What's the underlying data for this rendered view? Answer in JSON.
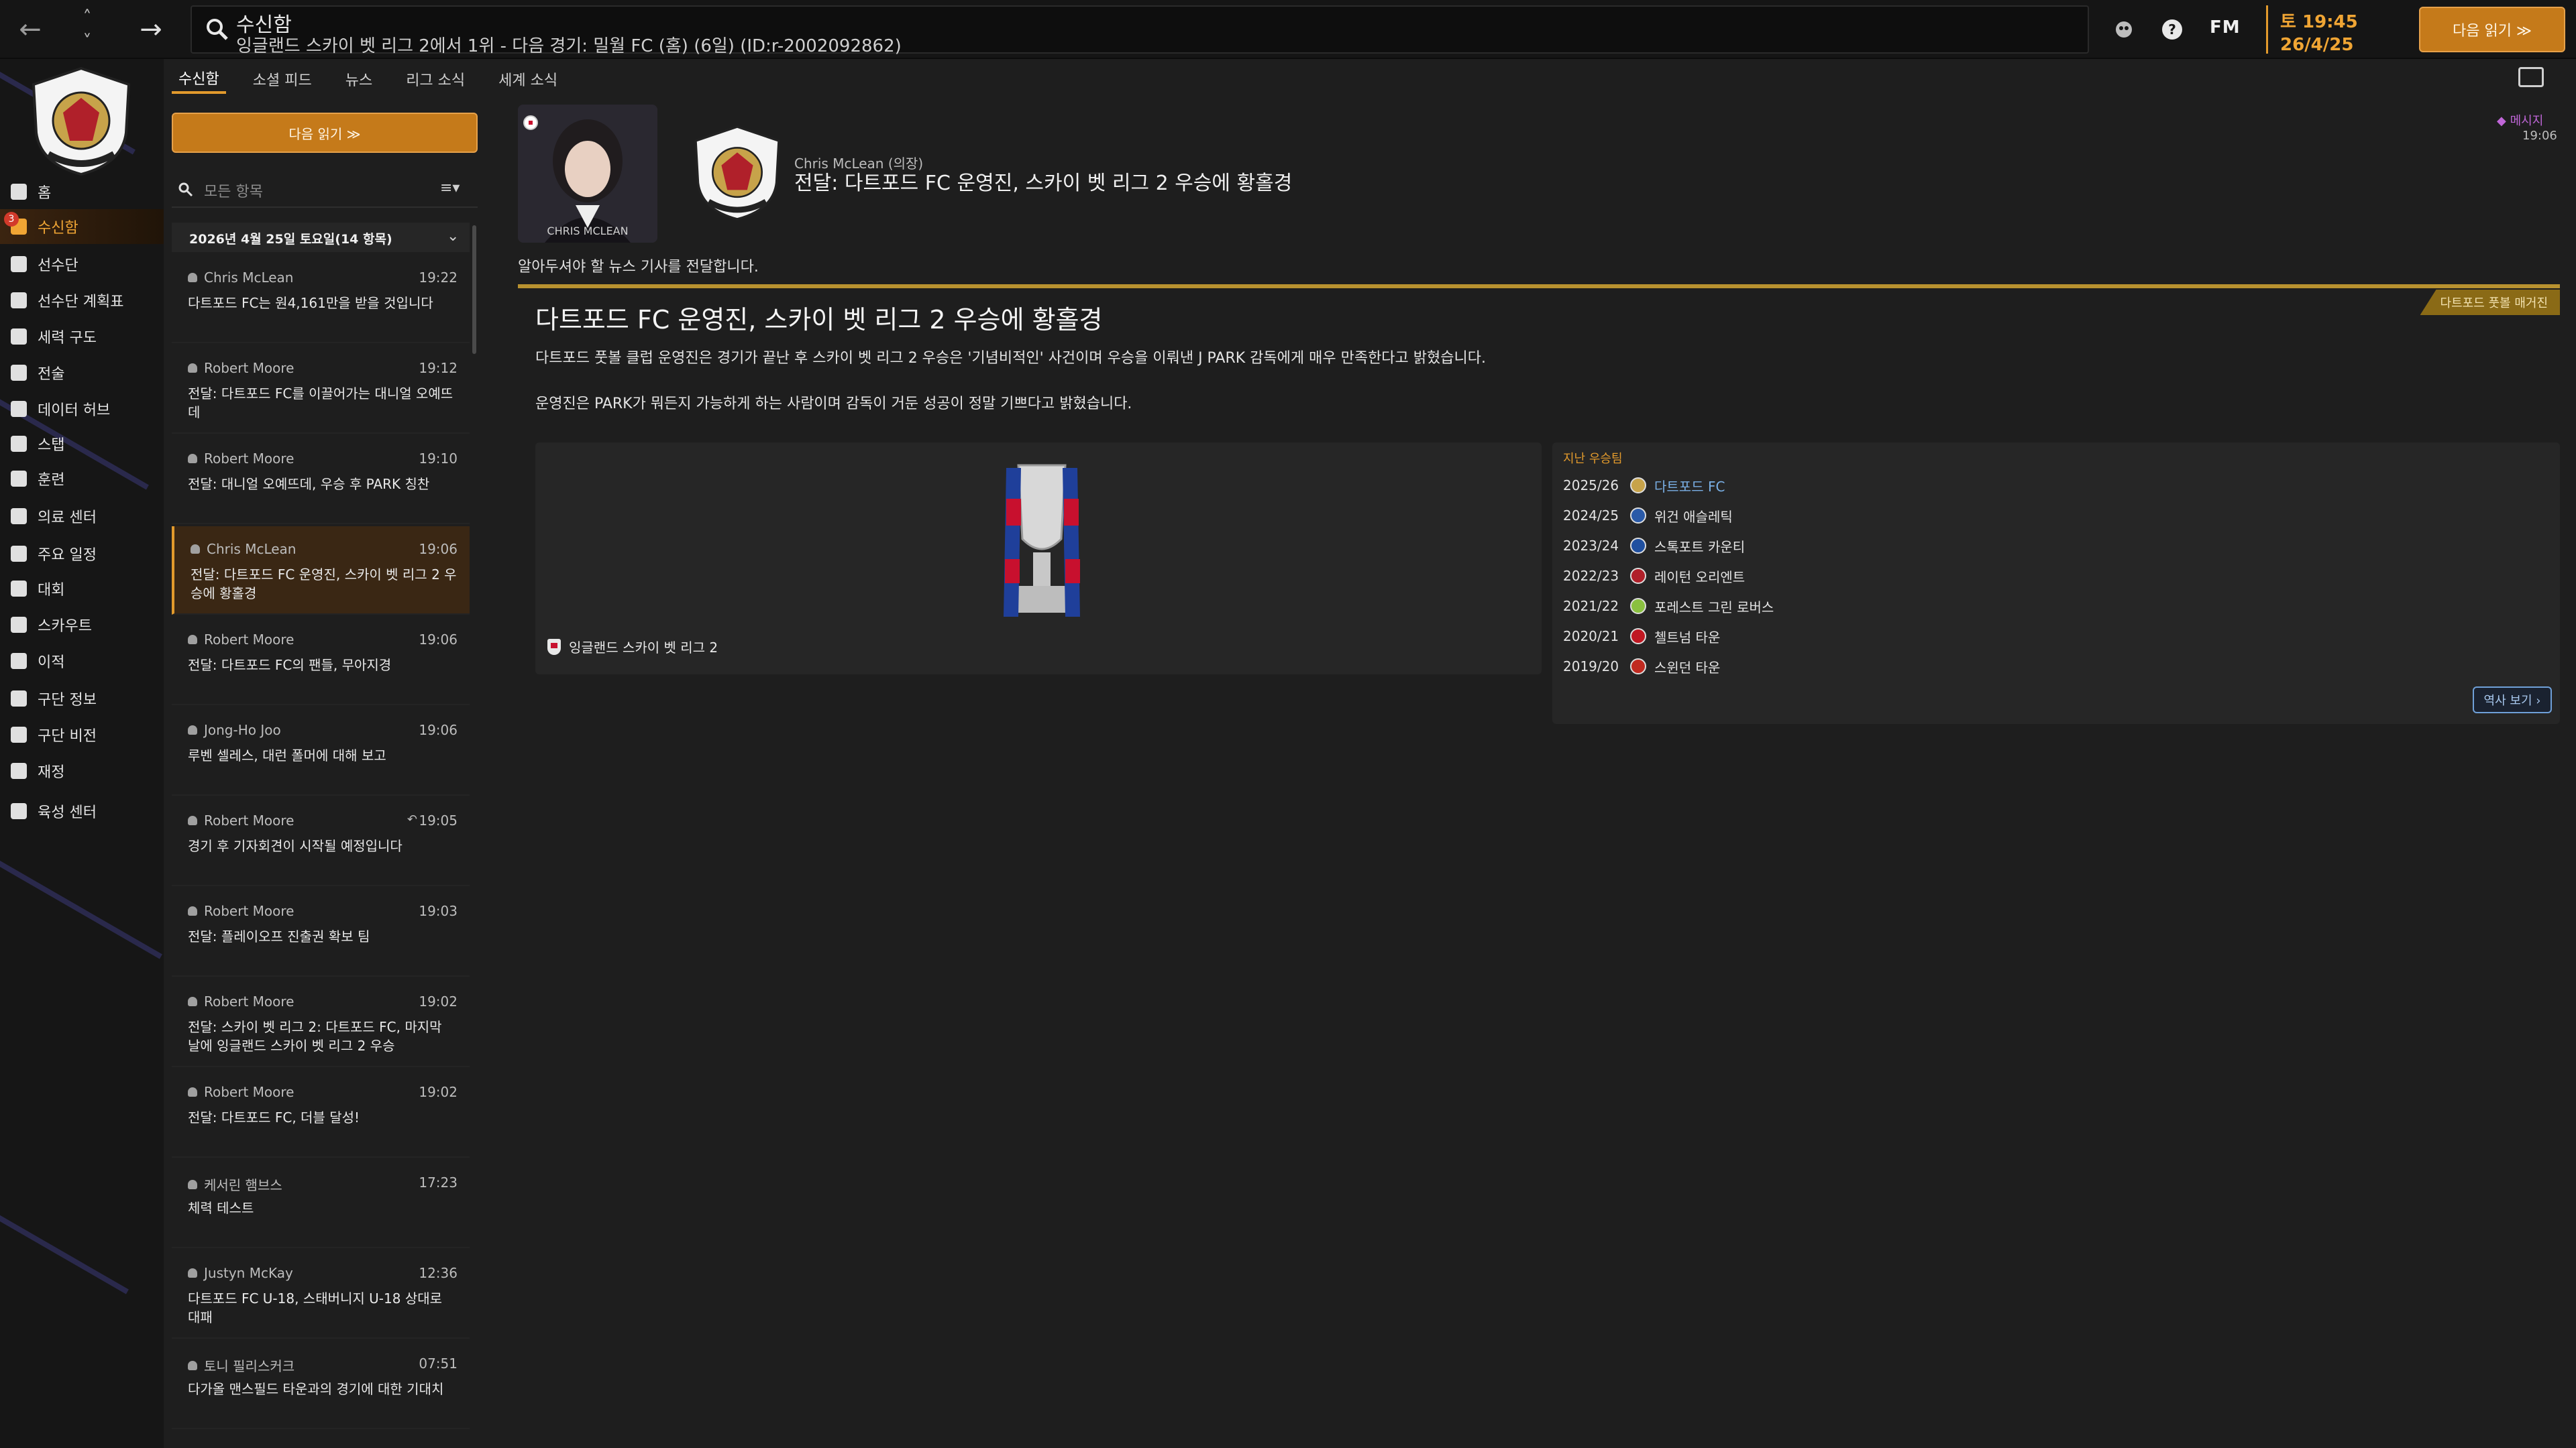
{
  "topbar": {
    "title": "수신함",
    "subtitle": "잉글랜드 스카이 벳 리그 2에서 1위 - 다음 경기: 밀월 FC (홈) (6일) (ID:r-2002092862)",
    "fm_label": "FM",
    "time": "토 19:45",
    "date": "26/4/25",
    "continue_label": "다음 읽기 ≫"
  },
  "sidebar": {
    "badge_count": "3",
    "items": [
      {
        "label": "홈",
        "icon": "home-icon"
      },
      {
        "label": "수신함",
        "icon": "inbox-icon"
      },
      {
        "label": "선수단",
        "icon": "squad-icon"
      },
      {
        "label": "선수단 계획표",
        "icon": "squad-planner-icon"
      },
      {
        "label": "세력 구도",
        "icon": "dynamics-icon"
      },
      {
        "label": "전술",
        "icon": "tactics-icon"
      },
      {
        "label": "데이터 허브",
        "icon": "data-hub-icon"
      },
      {
        "label": "스탭",
        "icon": "staff-icon"
      },
      {
        "label": "훈련",
        "icon": "training-icon"
      },
      {
        "label": "의료 센터",
        "icon": "medical-icon"
      },
      {
        "label": "주요 일정",
        "icon": "schedule-icon"
      },
      {
        "label": "대회",
        "icon": "trophy-icon"
      },
      {
        "label": "스카우트",
        "icon": "scouting-icon"
      },
      {
        "label": "이적",
        "icon": "transfers-icon"
      },
      {
        "label": "구단 정보",
        "icon": "club-info-icon"
      },
      {
        "label": "구단 비전",
        "icon": "club-vision-icon"
      },
      {
        "label": "재정",
        "icon": "finances-icon"
      },
      {
        "label": "육성 센터",
        "icon": "development-icon"
      }
    ]
  },
  "tabs": [
    "수신함",
    "소셜 피드",
    "뉴스",
    "리그 소식",
    "세계 소식"
  ],
  "inbox": {
    "continue_label": "다음 읽기 ≫",
    "filter_placeholder": "모든 항목",
    "sort_icon": "≡▾",
    "date_header": "2026년 4월 25일 토요일(14 항목)",
    "messages": [
      {
        "from": "Chris McLean",
        "time": "19:22",
        "subject": "다트포드 FC는 원4,161만을 받을 것입니다"
      },
      {
        "from": "Robert Moore",
        "time": "19:12",
        "subject": "전달: 다트포드 FC를 이끌어가는 대니얼 오예뜨데"
      },
      {
        "from": "Robert Moore",
        "time": "19:10",
        "subject": "전달: 대니얼 오예뜨데, 우승 후 PARK 칭찬"
      },
      {
        "from": "Chris McLean",
        "time": "19:06",
        "subject": "전달: 다트포드 FC 운영진, 스카이 벳 리그 2 우승에 황홀경"
      },
      {
        "from": "Robert Moore",
        "time": "19:06",
        "subject": "전달: 다트포드 FC의 팬들, 무아지경"
      },
      {
        "from": "Jong-Ho Joo",
        "time": "19:06",
        "subject": "루벤 셀레스, 대런 폴머에 대해 보고"
      },
      {
        "from": "Robert Moore",
        "time": "19:05",
        "subject": "경기 후 기자회견이 시작될 예정입니다"
      },
      {
        "from": "Robert Moore",
        "time": "19:03",
        "subject": "전달: 플레이오프 진출권 확보 팀"
      },
      {
        "from": "Robert Moore",
        "time": "19:02",
        "subject": "전달: 스카이 벳 리그 2: 다트포드 FC, 마지막 날에 잉글랜드 스카이 벳 리그 2 우승"
      },
      {
        "from": "Robert Moore",
        "time": "19:02",
        "subject": "전달: 다트포드 FC, 더블 달성!"
      },
      {
        "from": "케서린 햄브스",
        "time": "17:23",
        "subject": "체력 테스트"
      },
      {
        "from": "Justyn McKay",
        "time": "12:36",
        "subject": "다트포드 FC U-18, 스태버니지 U-18 상대로 대패"
      },
      {
        "from": "토니 필리스커크",
        "time": "07:51",
        "subject": "다가올 맨스필드 타운과의 경기에 대한 기대치"
      }
    ]
  },
  "message": {
    "portrait_caption": "CHRIS MCLEAN",
    "sender": "Chris McLean (의장)",
    "subject": "전달: 다트포드 FC 운영진, 스카이 벳 리그 2 우승에 황홀경",
    "tag": "메시지",
    "time": "19:06",
    "intro": "알아두셔야 할 뉴스 기사를 전달합니다.",
    "source": "다트포드 풋볼 매거진",
    "headline": "다트포드 FC 운영진, 스카이 벳 리그 2 우승에 황홀경",
    "para1": "다트포드 풋볼 클럽 운영진은 경기가 끝난 후 스카이 벳 리그 2 우승은 '기념비적인' 사건이며 우승을 이뤄낸 J PARK 감독에게 매우 만족한다고 밝혔습니다.",
    "para2": "운영진은 PARK가 뭐든지 가능하게 하는 사람이며 감독이 거둔 성공이 정말 기쁘다고 밝혔습니다.",
    "competition": "잉글랜드 스카이 벳 리그 2",
    "winners_title": "지난 우승팀",
    "winners": [
      {
        "season": "2025/26",
        "club": "다트포드 FC",
        "color": "#c7a34a"
      },
      {
        "season": "2024/25",
        "club": "위건 애슬레틱",
        "color": "#2a5aa8"
      },
      {
        "season": "2023/24",
        "club": "스톡포트 카운티",
        "color": "#2050a0"
      },
      {
        "season": "2022/23",
        "club": "레이턴 오리엔트",
        "color": "#b0202a"
      },
      {
        "season": "2021/22",
        "club": "포레스트 그린 로버스",
        "color": "#8ac040"
      },
      {
        "season": "2020/21",
        "club": "첼트넘 타운",
        "color": "#c01822"
      },
      {
        "season": "2019/20",
        "club": "스윈던 타운",
        "color": "#c02a20"
      }
    ],
    "history_label": "역사 보기 ›"
  }
}
